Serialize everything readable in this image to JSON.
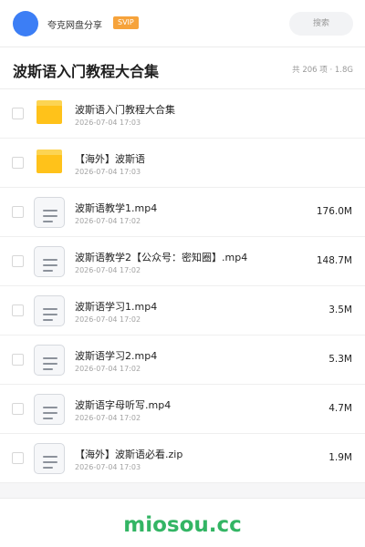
{
  "header": {
    "brand": "夸克网盘分享",
    "badge": "SVIP",
    "search_label": "搜索"
  },
  "page": {
    "title": "波斯语入门教程大合集",
    "summary": "共 206 项 · 1.8G"
  },
  "files": [
    {
      "name": "波斯语入门教程大合集",
      "date": "2026-07-04 17:03",
      "size": "",
      "type": "folder"
    },
    {
      "name": "【海外】波斯语",
      "date": "2026-07-04 17:03",
      "size": "",
      "type": "folder"
    },
    {
      "name": "波斯语教学1.mp4",
      "date": "2026-07-04 17:02",
      "size": "176.0M",
      "type": "file"
    },
    {
      "name": "波斯语教学2【公众号：密知圈】.mp4",
      "date": "2026-07-04 17:02",
      "size": "148.7M",
      "type": "file"
    },
    {
      "name": "波斯语学习1.mp4",
      "date": "2026-07-04 17:02",
      "size": "3.5M",
      "type": "file"
    },
    {
      "name": "波斯语学习2.mp4",
      "date": "2026-07-04 17:02",
      "size": "5.3M",
      "type": "file"
    },
    {
      "name": "波斯语字母听写.mp4",
      "date": "2026-07-04 17:02",
      "size": "4.7M",
      "type": "file"
    },
    {
      "name": "【海外】波斯语必看.zip",
      "date": "2026-07-04 17:03",
      "size": "1.9M",
      "type": "file"
    }
  ],
  "footer": {
    "watermark": "miosou.cc"
  },
  "colors": {
    "avatar": "#3c7ef5",
    "badge": "#f6a33b",
    "folder": "#ffc21a",
    "watermark": "#33b564"
  }
}
